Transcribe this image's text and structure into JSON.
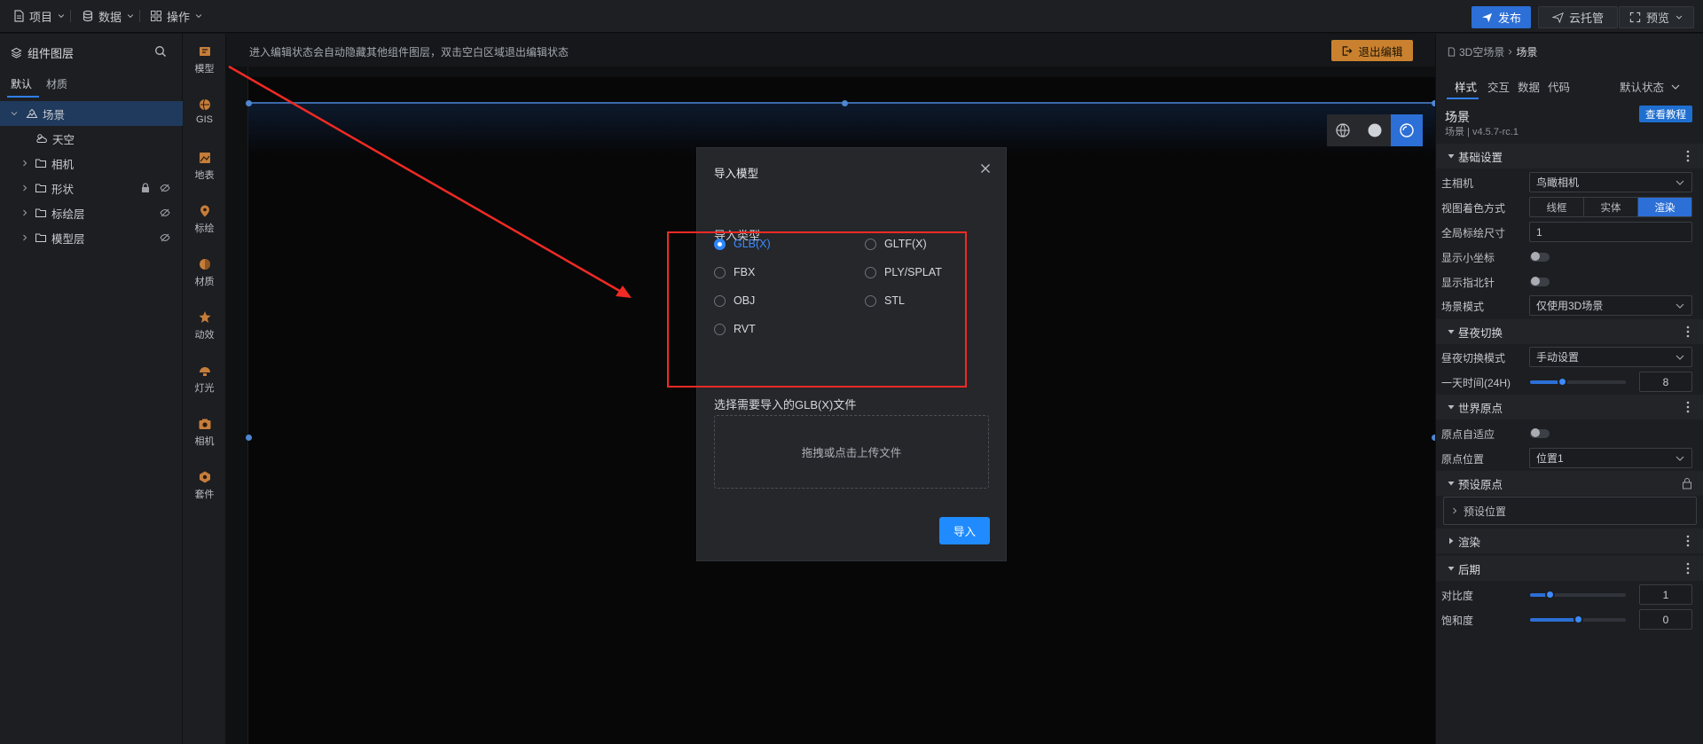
{
  "topbar": {
    "menus": [
      {
        "label": "项目",
        "icon": "file-icon"
      },
      {
        "label": "数据",
        "icon": "database-icon"
      },
      {
        "label": "操作",
        "icon": "grid-icon"
      }
    ],
    "publish_label": "发布",
    "cloud_label": "云托管",
    "preview_label": "预览"
  },
  "left_panel": {
    "title": "组件图层",
    "tabs": [
      "默认",
      "材质"
    ],
    "tree": [
      {
        "label": "场景",
        "icon": "scene-icon",
        "selected": true,
        "expanded": true,
        "level": 0
      },
      {
        "label": "天空",
        "icon": "sky-icon",
        "level": 1
      },
      {
        "label": "相机",
        "icon": "folder-icon",
        "level": 1
      },
      {
        "label": "形状",
        "icon": "folder-icon",
        "level": 1,
        "locked": true,
        "hidden": true
      },
      {
        "label": "标绘层",
        "icon": "folder-icon",
        "level": 1,
        "hidden": true
      },
      {
        "label": "模型层",
        "icon": "folder-icon",
        "level": 1,
        "hidden": true
      }
    ]
  },
  "icon_bar": [
    {
      "label": "模型",
      "icon": "model-icon"
    },
    {
      "label": "GIS",
      "icon": "gis-icon"
    },
    {
      "label": "地表",
      "icon": "terrain-icon"
    },
    {
      "label": "标绘",
      "icon": "marker-icon"
    },
    {
      "label": "材质",
      "icon": "material-icon"
    },
    {
      "label": "动效",
      "icon": "effect-icon"
    },
    {
      "label": "灯光",
      "icon": "light-icon"
    },
    {
      "label": "相机",
      "icon": "camera-icon"
    },
    {
      "label": "套件",
      "icon": "kit-icon"
    }
  ],
  "canvas": {
    "hint": "进入编辑状态会自动隐藏其他组件图层，双击空白区域退出编辑状态",
    "exit_label": "退出编辑"
  },
  "modal": {
    "title": "导入模型",
    "type_label": "导入类型",
    "options": [
      "GLB(X)",
      "GLTF(X)",
      "FBX",
      "PLY/SPLAT",
      "OBJ",
      "STL",
      "RVT"
    ],
    "selected": "GLB(X)",
    "file_label": "选择需要导入的GLB(X)文件",
    "drop_text": "拖拽或点击上传文件",
    "import_label": "导入"
  },
  "right_panel": {
    "breadcrumb": [
      "3D空场景",
      "场景"
    ],
    "tabs": [
      "样式",
      "交互",
      "数据",
      "代码"
    ],
    "state_label": "默认状态",
    "component_name": "场景",
    "version": "场景 | v4.5.7-rc.1",
    "tutorial_label": "查看教程",
    "sections": {
      "basic": "基础设置",
      "daynight": "昼夜切换",
      "world_origin": "世界原点",
      "preset_origin": "预设原点",
      "render": "渲染",
      "post": "后期"
    },
    "props": {
      "main_camera": {
        "label": "主相机",
        "value": "鸟瞰相机"
      },
      "view_shading": {
        "label": "视图着色方式",
        "options": [
          "线框",
          "实体",
          "渲染"
        ],
        "selected": "渲染"
      },
      "global_marker_size": {
        "label": "全局标绘尺寸",
        "value": "1"
      },
      "show_axes": {
        "label": "显示小坐标",
        "on": false
      },
      "show_compass": {
        "label": "显示指北针",
        "on": false
      },
      "scene_mode": {
        "label": "场景模式",
        "value": "仅使用3D场景"
      },
      "daynight_mode": {
        "label": "昼夜切换模式",
        "value": "手动设置"
      },
      "time_of_day": {
        "label": "一天时间(24H)",
        "value": "8",
        "fraction": 0.33
      },
      "origin_adaptive": {
        "label": "原点自适应",
        "on": false
      },
      "origin_position": {
        "label": "原点位置",
        "value": "位置1"
      },
      "preset_position": "预设位置",
      "contrast": {
        "label": "对比度",
        "value": "1",
        "fraction": 0.2
      },
      "saturation": {
        "label": "饱和度",
        "value": "0",
        "fraction": 0.5
      }
    }
  },
  "colors": {
    "accent": "#2c6fd6",
    "annotation_red": "#f02a24",
    "exit_orange": "#c9812f"
  }
}
